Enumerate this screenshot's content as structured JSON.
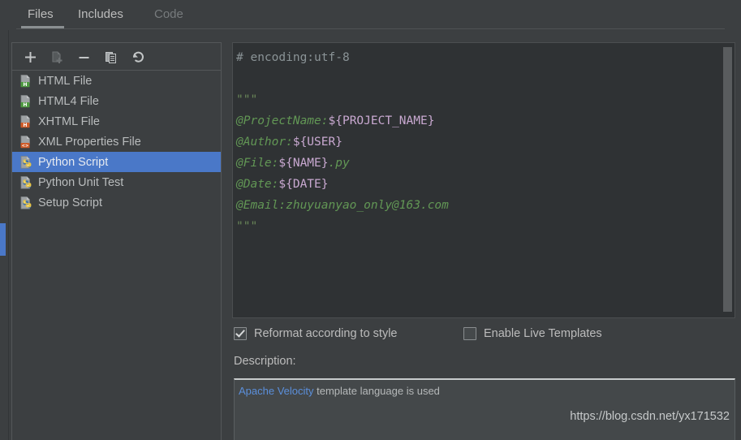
{
  "window": {
    "bg_color": "#3c3f41",
    "accent_color": "#4a78c8"
  },
  "tabs": [
    {
      "label": "Files",
      "active": true,
      "dim": false
    },
    {
      "label": "Includes",
      "active": false,
      "dim": false
    },
    {
      "label": "Code",
      "active": false,
      "dim": true
    }
  ],
  "toolbar": {
    "buttons": [
      {
        "name": "add-button",
        "icon": "plus-icon",
        "enabled": true
      },
      {
        "name": "duplicate-button",
        "icon": "copy-file-icon",
        "enabled": false
      },
      {
        "name": "remove-button",
        "icon": "minus-icon",
        "enabled": true
      },
      {
        "name": "copy-button",
        "icon": "copy-icon",
        "enabled": true
      },
      {
        "name": "reset-button",
        "icon": "undo-icon",
        "enabled": true
      }
    ]
  },
  "file_list": {
    "items": [
      {
        "label": "HTML File",
        "icon": "html-file-icon",
        "badge": "H",
        "badge_color": "#4e9a41",
        "selected": false
      },
      {
        "label": "HTML4 File",
        "icon": "html-file-icon",
        "badge": "H",
        "badge_color": "#4e9a41",
        "selected": false
      },
      {
        "label": "XHTML File",
        "icon": "xhtml-file-icon",
        "badge": "H",
        "badge_color": "#cf5b28",
        "selected": false
      },
      {
        "label": "XML Properties File",
        "icon": "xml-file-icon",
        "badge": "<>",
        "badge_color": "#cf5b28",
        "selected": false
      },
      {
        "label": "Python Script",
        "icon": "python-file-icon",
        "badge": "",
        "badge_color": "#3d72a8",
        "selected": true
      },
      {
        "label": "Python Unit Test",
        "icon": "python-file-icon",
        "badge": "",
        "badge_color": "#3d72a8",
        "selected": false
      },
      {
        "label": "Setup Script",
        "icon": "python-file-icon",
        "badge": "",
        "badge_color": "#3d72a8",
        "selected": false
      }
    ]
  },
  "editor": {
    "lines": [
      [
        {
          "t": "# encoding:utf-8",
          "c": "c-comment"
        }
      ],
      [
        {
          "t": "",
          "c": ""
        }
      ],
      [
        {
          "t": "\"\"\"",
          "c": "c-str"
        }
      ],
      [
        {
          "t": "@ProjectName:",
          "c": "c-doc"
        },
        {
          "t": "${PROJECT_NAME}",
          "c": "c-var"
        }
      ],
      [
        {
          "t": "@Author:",
          "c": "c-doc"
        },
        {
          "t": "${USER}",
          "c": "c-var"
        }
      ],
      [
        {
          "t": "@File:",
          "c": "c-doc"
        },
        {
          "t": "${NAME}",
          "c": "c-var"
        },
        {
          "t": ".py",
          "c": "c-doc"
        }
      ],
      [
        {
          "t": "@Date:",
          "c": "c-doc"
        },
        {
          "t": "${DATE}",
          "c": "c-var"
        }
      ],
      [
        {
          "t": "@Email:zhuyuanyao_only@163.com",
          "c": "c-doc"
        }
      ],
      [
        {
          "t": "\"\"\"",
          "c": "c-str"
        }
      ]
    ]
  },
  "options": {
    "reformat": {
      "label": "Reformat according to style",
      "checked": true
    },
    "live_templates": {
      "label": "Enable Live Templates",
      "checked": false
    }
  },
  "description": {
    "label": "Description:",
    "link_text": "Apache Velocity",
    "rest_text": " template language is used"
  },
  "watermark": {
    "text": "https://blog.csdn.net/yx171532"
  }
}
